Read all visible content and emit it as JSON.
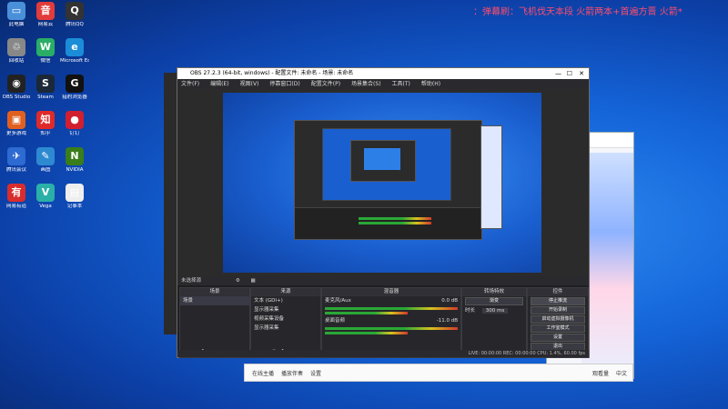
{
  "desktop": {
    "marquee": "：弹幕刷：飞机伐天本段  火箭两本+首遍方晋  火箭*",
    "icons": [
      {
        "label": "此电脑",
        "glyph": "▭",
        "color": "#4a90d9"
      },
      {
        "label": "网易云",
        "glyph": "音",
        "color": "#e23b3b"
      },
      {
        "label": "腾讯QQ",
        "glyph": "Q",
        "color": "#333"
      },
      {
        "label": "回收站",
        "glyph": "♲",
        "color": "#888"
      },
      {
        "label": "微信",
        "glyph": "W",
        "color": "#2aae67"
      },
      {
        "label": "Microsoft Edge",
        "glyph": "e",
        "color": "#1b8dd8"
      },
      {
        "label": "OBS Studio",
        "glyph": "◉",
        "color": "#222"
      },
      {
        "label": "Steam",
        "glyph": "S",
        "color": "#1b2838"
      },
      {
        "label": "猎豹浏览器",
        "glyph": "G",
        "color": "#111"
      },
      {
        "label": "更多游戏",
        "glyph": "▣",
        "color": "#e06020"
      },
      {
        "label": "知乎",
        "glyph": "知",
        "color": "#e02a2a"
      },
      {
        "label": "钉钉",
        "glyph": "●",
        "color": "#d21f2f"
      },
      {
        "label": "腾讯会议",
        "glyph": "✈",
        "color": "#2d6ad1"
      },
      {
        "label": "画图",
        "glyph": "✎",
        "color": "#2d8ad1"
      },
      {
        "label": "NVIDIA",
        "glyph": "N",
        "color": "#3a7d1b"
      },
      {
        "label": "网易有道",
        "glyph": "有",
        "color": "#d92d2d"
      },
      {
        "label": "Vega",
        "glyph": "V",
        "color": "#2bb0a8"
      },
      {
        "label": "记事本",
        "glyph": "▤",
        "color": "#eee"
      }
    ]
  },
  "obs": {
    "title": "OBS 27.2.3 (64-bit, windows) - 配置文件: 未命名 - 场景: 未命名",
    "menu": [
      "文件(F)",
      "编辑(E)",
      "视图(V)",
      "停靠窗口(D)",
      "配置文件(P)",
      "场景集合(S)",
      "工具(T)",
      "帮助(H)"
    ],
    "source_bar": "未选择源",
    "docks": {
      "scenes": {
        "title": "场景",
        "items": [
          "场景"
        ]
      },
      "sources": {
        "title": "来源",
        "items": [
          "文本 (GDI+)",
          "显示器采集",
          "视频采集设备",
          "显示器采集"
        ]
      },
      "mixer": {
        "title": "混音器",
        "tracks": [
          {
            "name": "麦克风/Aux",
            "db": "0.0 dB"
          },
          {
            "name": "桌面音频",
            "db": "-11.0 dB"
          }
        ]
      },
      "transitions": {
        "title": "转场特效",
        "type": "渐变",
        "duration_label": "时长",
        "duration": "300 ms"
      },
      "controls": {
        "title": "控件",
        "buttons": [
          "停止推流",
          "开始录制",
          "启动虚拟摄像机",
          "工作室模式",
          "设置",
          "退出"
        ]
      }
    },
    "status": "LIVE: 00:00:00   REC: 00:00:00   CPU: 1.4%, 60.00 fps"
  },
  "bottom_bar": {
    "items": [
      "在线主播",
      "播放伴奏",
      "设置"
    ],
    "extra": "观看量",
    "lang": "中文"
  }
}
